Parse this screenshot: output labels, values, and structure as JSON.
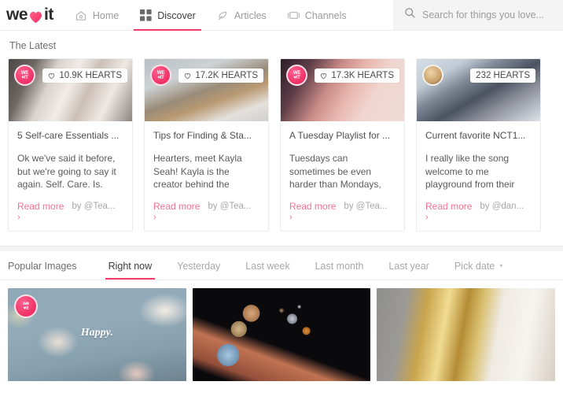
{
  "brand": {
    "logo_left": "we",
    "logo_heart_icon": "heart-icon",
    "logo_right": "it",
    "accent_pink": "#ef3d66",
    "link_pink": "#f4728f"
  },
  "nav": {
    "items": [
      {
        "label": "Home",
        "icon": "home-icon",
        "active": false
      },
      {
        "label": "Discover",
        "icon": "grid-icon",
        "active": true
      },
      {
        "label": "Articles",
        "icon": "feather-icon",
        "active": false
      },
      {
        "label": "Channels",
        "icon": "tv-icon",
        "active": false
      }
    ]
  },
  "search": {
    "icon": "search-icon",
    "placeholder": "Search for things you love...",
    "value": ""
  },
  "latest": {
    "title": "The Latest",
    "cards": [
      {
        "avatar": "we-heart-it-logo-avatar",
        "hearts": "10.9K HEARTS",
        "hearts_icon": "heart-outline-icon",
        "title": "5 Self-care Essentials ...",
        "excerpt": "Ok we've said it before, but we're going to say it again. Self. Care. Is.",
        "read_more": "Read more",
        "chevron": "›",
        "byline": "by @Tea..."
      },
      {
        "avatar": "we-heart-it-logo-avatar",
        "hearts": "17.2K HEARTS",
        "hearts_icon": "heart-outline-icon",
        "title": "Tips for Finding & Sta...",
        "excerpt": "Hearters, meet Kayla Seah! Kayla is the creator behind the",
        "read_more": "Read more",
        "chevron": "›",
        "byline": "by @Tea..."
      },
      {
        "avatar": "we-heart-it-logo-avatar",
        "hearts": "17.3K HEARTS",
        "hearts_icon": "heart-outline-icon",
        "title": "A Tuesday Playlist for ...",
        "excerpt": "Tuesdays can sometimes be even harder than Mondays,",
        "read_more": "Read more",
        "chevron": "›",
        "byline": "by @Tea..."
      },
      {
        "avatar": "user-photo-avatar",
        "hearts": "232 HEARTS",
        "hearts_icon": "none",
        "title": "Current favorite NCT1...",
        "excerpt": "I really like the song welcome to me playground from their",
        "read_more": "Read more",
        "chevron": "›",
        "byline": "by @dan..."
      }
    ]
  },
  "popular": {
    "label": "Popular Images",
    "filters": [
      {
        "label": "Right now",
        "active": true
      },
      {
        "label": "Yesterday",
        "active": false
      },
      {
        "label": "Last week",
        "active": false
      },
      {
        "label": "Last month",
        "active": false
      },
      {
        "label": "Last year",
        "active": false
      },
      {
        "label": "Pick date",
        "active": false,
        "caret": "▾"
      }
    ],
    "tiles": [
      {
        "name": "flowers-happy-image",
        "overlay_text": "Happy.",
        "avatar": "we-heart-it-logo-avatar"
      },
      {
        "name": "planets-space-image",
        "overlay_text": "",
        "avatar": "none"
      },
      {
        "name": "gold-frame-satin-image",
        "overlay_text": "",
        "avatar": "none"
      }
    ]
  }
}
